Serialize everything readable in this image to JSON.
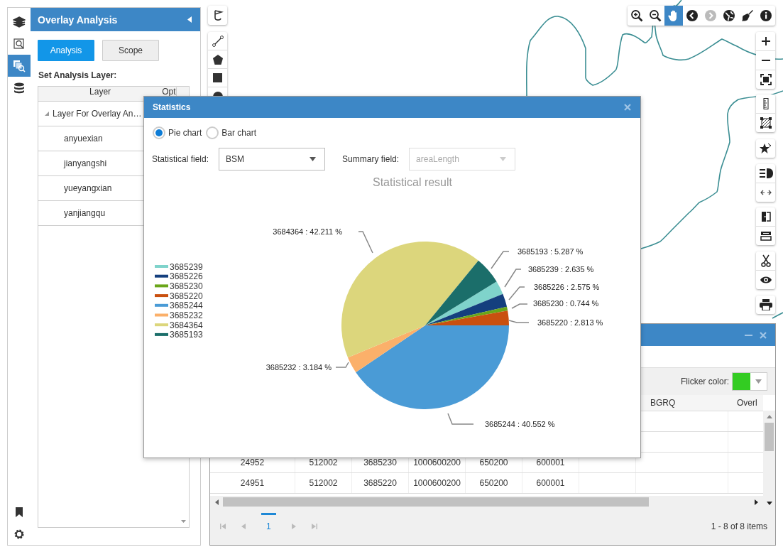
{
  "rail": {
    "items": [
      {
        "selected": false
      },
      {
        "selected": false
      },
      {
        "selected": true
      },
      {
        "selected": false
      }
    ]
  },
  "panel": {
    "title": "Overlay Analysis",
    "tabs": [
      {
        "label": "Analysis",
        "selected": true
      },
      {
        "label": "Scope",
        "selected": false
      }
    ],
    "section_label": "Set Analysis Layer:",
    "layer_table": {
      "columns": [
        "Layer",
        "Opt"
      ],
      "tree": {
        "label": "Layer For Overlay An…",
        "expanded": true,
        "children": [
          {
            "label": "anyuexian"
          },
          {
            "label": "jianyangshi"
          },
          {
            "label": "yueyangxian"
          },
          {
            "label": "yanjiangqu"
          }
        ]
      }
    }
  },
  "map_toolbar": {
    "tools": [
      {
        "selected": false,
        "disabled": false
      },
      {
        "selected": false,
        "disabled": false
      },
      {
        "selected": true,
        "disabled": false
      },
      {
        "selected": false,
        "disabled": false
      },
      {
        "selected": false,
        "disabled": true
      },
      {
        "selected": false,
        "disabled": false
      },
      {
        "selected": false,
        "disabled": false
      },
      {
        "selected": false,
        "disabled": false
      }
    ]
  },
  "statistics_dialog": {
    "title": "Statistics",
    "chart_types": [
      {
        "label": "Pie chart",
        "selected": true
      },
      {
        "label": "Bar chart",
        "selected": false
      }
    ],
    "statistical_field": {
      "label": "Statistical field:",
      "value": "BSM",
      "disabled": false
    },
    "summary_field": {
      "label": "Summary field:",
      "value": "areaLength",
      "disabled": true
    },
    "chart_data": {
      "type": "pie",
      "title": "Statistical result",
      "legend": "left",
      "categories": [
        "3685239",
        "3685226",
        "3685230",
        "3685220",
        "3685244",
        "3685232",
        "3684364",
        "3685193"
      ],
      "values": [
        2.635,
        2.575,
        0.744,
        2.813,
        40.552,
        3.184,
        42.211,
        5.287
      ],
      "value_labels": [
        "3685239 : 2.635 %",
        "3685226 : 2.575 %",
        "3685230 : 0.744 %",
        "3685220 : 2.813 %",
        "3685244 : 40.552 %",
        "3685232 : 3.184 %",
        "3684364 : 42.211 %",
        "3685193 : 5.287 %"
      ]
    }
  },
  "result_window": {
    "flicker_color": {
      "label": "Flicker color:",
      "color": "#33cc22"
    },
    "columns": [
      "BGRQ",
      "Overl"
    ],
    "rows": [
      [
        "24952",
        "512002",
        "3685230",
        "1000600200",
        "650200",
        "600001"
      ],
      [
        "24951",
        "512002",
        "3685220",
        "1000600200",
        "650200",
        "600001"
      ]
    ],
    "pager": {
      "pages": [
        {
          "label": "1",
          "selected": true
        }
      ],
      "summary": "1 - 8 of 8 items"
    }
  }
}
